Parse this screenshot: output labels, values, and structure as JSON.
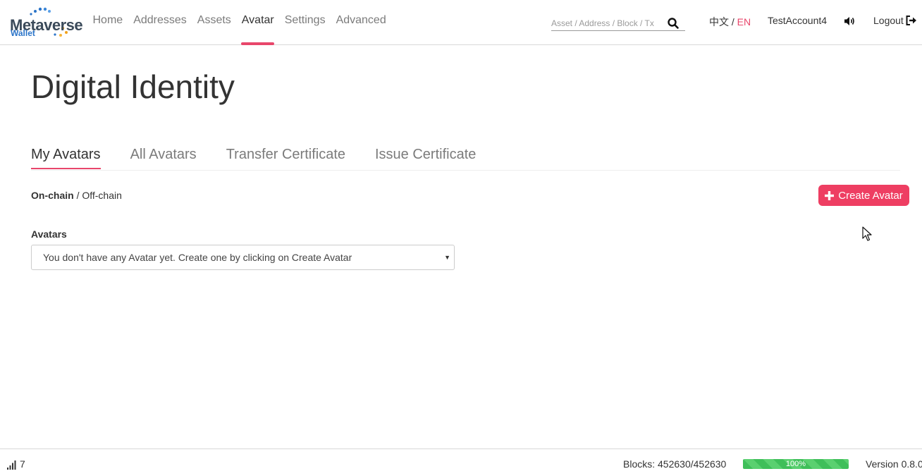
{
  "brand": {
    "name": "Metaverse",
    "sub": "Wallet"
  },
  "nav": {
    "links": [
      "Home",
      "Addresses",
      "Assets",
      "Avatar",
      "Settings",
      "Advanced"
    ],
    "active": "Avatar"
  },
  "search": {
    "placeholder": "Asset / Address / Block / Tx"
  },
  "language": {
    "zh": "中文",
    "separator": "/",
    "en": "EN",
    "active": "EN"
  },
  "account": {
    "name": "TestAccount4"
  },
  "logout_label": "Logout",
  "page": {
    "title": "Digital Identity"
  },
  "tabs": [
    "My Avatars",
    "All Avatars",
    "Transfer Certificate",
    "Issue Certificate"
  ],
  "tabs_active": "My Avatars",
  "chain_toggle": {
    "on_chain": "On-chain",
    "separator": "/",
    "off_chain": "Off-chain",
    "active": "On-chain"
  },
  "create_button": {
    "label": "Create Avatar"
  },
  "avatars_field": {
    "label": "Avatars",
    "selected": "You don't have any Avatar yet. Create one by clicking on Create Avatar"
  },
  "footer": {
    "peers": "7",
    "blocks": "Blocks: 452630/452630",
    "sync_progress": 1.0,
    "sync_label": "100%",
    "version": "Version 0.8.0"
  },
  "colors": {
    "accent": "#e8466b",
    "button": "#ee3e62",
    "progress": "#3fbf5a",
    "logo_blue": "#2b74c8"
  },
  "icons": [
    "search-icon",
    "speaker-icon",
    "logout-icon",
    "plus-icon",
    "signal-icon",
    "chevron-down-icon",
    "mouse-cursor-icon"
  ]
}
